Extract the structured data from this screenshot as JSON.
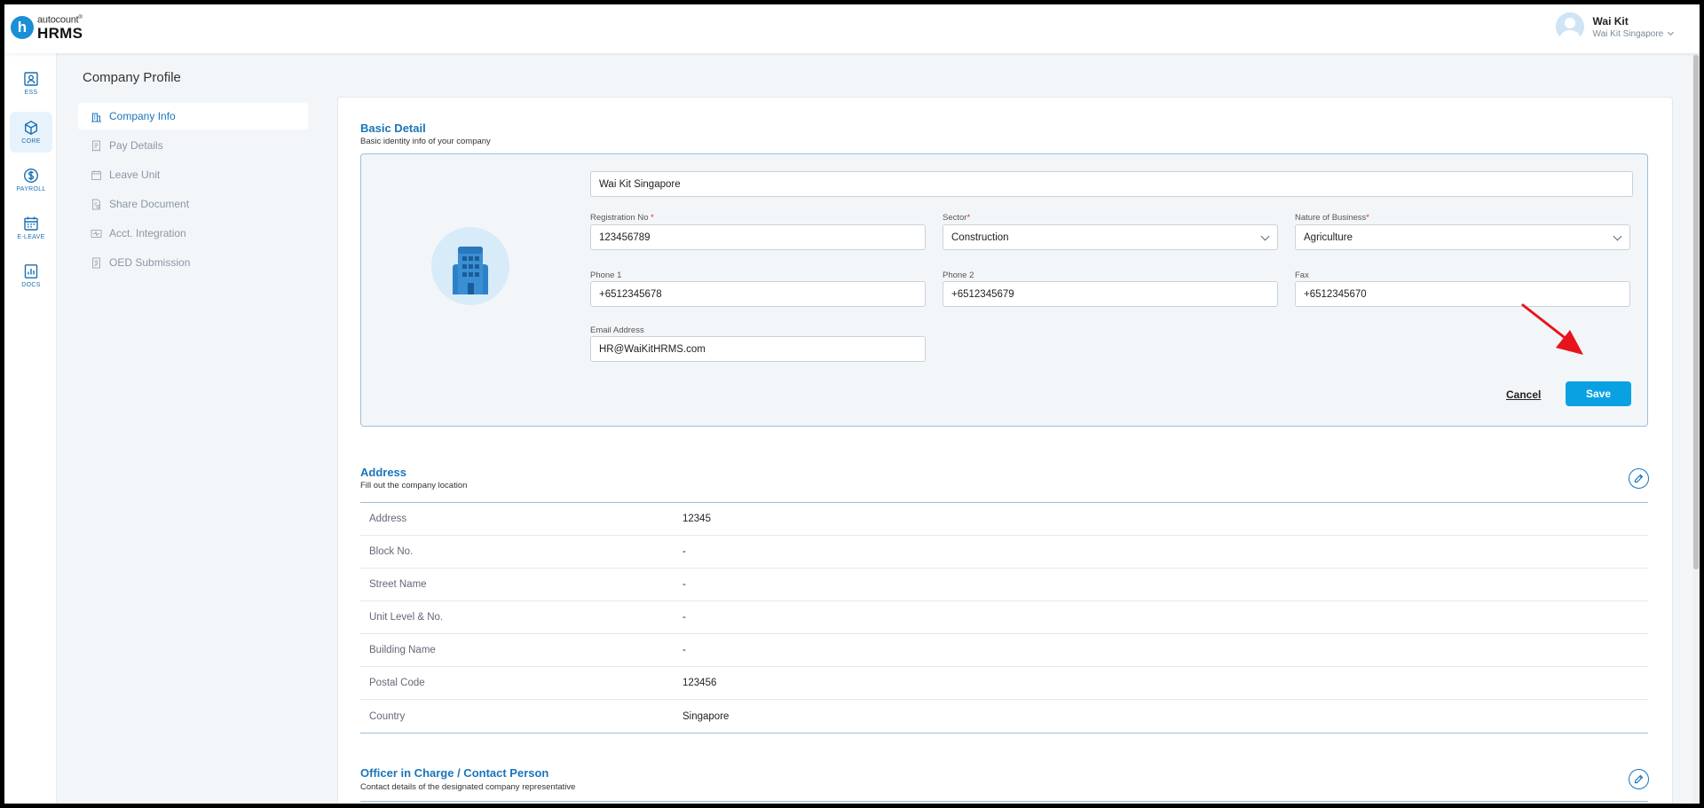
{
  "app": {
    "logo_sub": "autocount",
    "logo_reg": "®",
    "logo_main": "HRMS",
    "logo_letter": "h"
  },
  "user": {
    "name": "Wai Kit",
    "company": "Wai Kit Singapore"
  },
  "rail": {
    "items": [
      {
        "label": "ESS",
        "icon": "badge-icon"
      },
      {
        "label": "CORE",
        "icon": "cube-icon"
      },
      {
        "label": "PAYROLL",
        "icon": "dollar-icon"
      },
      {
        "label": "E-LEAVE",
        "icon": "calendar-icon"
      },
      {
        "label": "DOCS",
        "icon": "chart-doc-icon"
      }
    ],
    "active": "CORE"
  },
  "page": {
    "title": "Company Profile"
  },
  "subnav": {
    "items": [
      {
        "label": "Company Info"
      },
      {
        "label": "Pay Details"
      },
      {
        "label": "Leave Unit"
      },
      {
        "label": "Share Document"
      },
      {
        "label": "Acct. Integration"
      },
      {
        "label": "OED Submission"
      }
    ]
  },
  "basic": {
    "title": "Basic Detail",
    "subtitle": "Basic identity info of your company",
    "company_name": "Wai Kit Singapore",
    "reg_label": "Registration No",
    "reg_value": "123456789",
    "sector_label": "Sector",
    "sector_value": "Construction",
    "nature_label": "Nature of Business",
    "nature_value": "Agriculture",
    "phone1_label": "Phone 1",
    "phone1_value": "+6512345678",
    "phone2_label": "Phone 2",
    "phone2_value": "+6512345679",
    "fax_label": "Fax",
    "fax_value": "+6512345670",
    "email_label": "Email Address",
    "email_value": "HR@WaiKitHRMS.com",
    "required_mark": "*",
    "cancel": "Cancel",
    "save": "Save"
  },
  "address": {
    "title": "Address",
    "subtitle": "Fill out the company location",
    "rows": [
      {
        "label": "Address",
        "value": "12345"
      },
      {
        "label": "Block No.",
        "value": "-"
      },
      {
        "label": "Street Name",
        "value": "-"
      },
      {
        "label": "Unit Level & No.",
        "value": "-"
      },
      {
        "label": "Building Name",
        "value": "-"
      },
      {
        "label": "Postal Code",
        "value": "123456"
      },
      {
        "label": "Country",
        "value": "Singapore"
      }
    ]
  },
  "officer": {
    "title": "Officer in Charge / Contact Person",
    "subtitle": "Contact details of the designated company representative"
  },
  "colors": {
    "accent": "#1a75bb",
    "save": "#0aa1e3",
    "arrow": "#e8141c"
  }
}
